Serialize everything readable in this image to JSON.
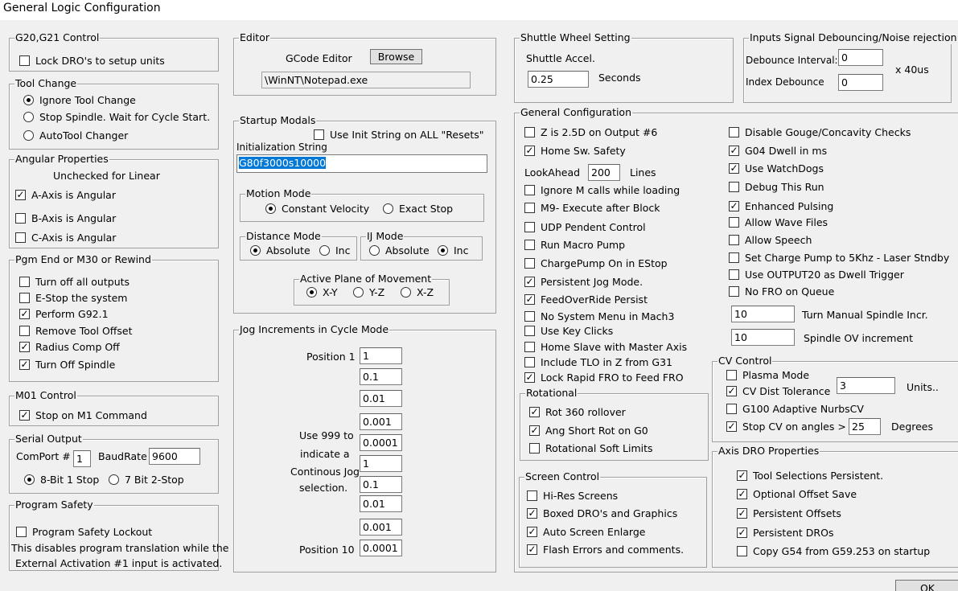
{
  "window": {
    "title": "General Logic Configuration",
    "ok_label": "OK"
  },
  "g20": {
    "legend": "G20,G21 Control",
    "lock_dro": {
      "label": "Lock DRO's to setup units",
      "checked": false
    }
  },
  "tool_change": {
    "legend": "Tool Change",
    "options": [
      {
        "label": "Ignore Tool Change",
        "selected": true
      },
      {
        "label": "Stop Spindle. Wait for Cycle Start.",
        "selected": false
      },
      {
        "label": "AutoTool Changer",
        "selected": false
      }
    ]
  },
  "angular": {
    "legend": "Angular Properties",
    "note": "Unchecked for Linear",
    "items": [
      {
        "label": "A-Axis is Angular",
        "checked": true
      },
      {
        "label": "B-Axis is Angular",
        "checked": false
      },
      {
        "label": "C-Axis is Angular",
        "checked": false
      }
    ]
  },
  "pgm_end": {
    "legend": "Pgm End or M30 or Rewind",
    "items": [
      {
        "label": "Turn off all outputs",
        "checked": false
      },
      {
        "label": "E-Stop the system",
        "checked": false
      },
      {
        "label": "Perform G92.1",
        "checked": true
      },
      {
        "label": "Remove Tool Offset",
        "checked": false
      },
      {
        "label": "Radius Comp Off",
        "checked": true
      },
      {
        "label": "Turn Off Spindle",
        "checked": true
      }
    ]
  },
  "m01": {
    "legend": "M01 Control",
    "stop_m1": {
      "label": "Stop on M1 Command",
      "checked": true
    }
  },
  "serial": {
    "legend": "Serial Output",
    "comport_label": "ComPort #",
    "comport_value": "1",
    "baud_label": "BaudRate",
    "baud_value": "9600",
    "bits_8": {
      "label": "8-Bit 1 Stop",
      "selected": true
    },
    "bits_7": {
      "label": "7 Bit 2-Stop",
      "selected": false
    }
  },
  "safety": {
    "legend": "Program Safety",
    "lockout": {
      "label": "Program Safety Lockout",
      "checked": false
    },
    "desc1": "This disables program translation while the",
    "desc2": "External Activation #1 input is activated."
  },
  "editor": {
    "legend": "Editor",
    "label": "GCode Editor",
    "browse": "Browse",
    "path": "\\WinNT\\Notepad.exe"
  },
  "startup": {
    "legend": "Startup Modals",
    "use_init": {
      "label": "Use Init String on ALL  \"Resets\"",
      "checked": false
    },
    "init_label": "Initialization String",
    "init_value": "G80f3000s10000",
    "motion": {
      "legend": "Motion Mode",
      "cv": {
        "label": "Constant Velocity",
        "selected": true
      },
      "es": {
        "label": "Exact Stop",
        "selected": false
      }
    },
    "distance": {
      "legend": "Distance Mode",
      "abs": {
        "label": "Absolute",
        "selected": true
      },
      "inc": {
        "label": "Inc",
        "selected": false
      }
    },
    "ij": {
      "legend": "IJ Mode",
      "abs": {
        "label": "Absolute",
        "selected": false
      },
      "inc": {
        "label": "Inc",
        "selected": true
      }
    },
    "plane": {
      "legend": "Active Plane of Movement",
      "xy": {
        "label": "X-Y",
        "selected": true
      },
      "yz": {
        "label": "Y-Z",
        "selected": false
      },
      "xz": {
        "label": "X-Z",
        "selected": false
      }
    }
  },
  "jog": {
    "legend": "Jog Increments in Cycle Mode",
    "pos1": "Position 1",
    "pos10": "Position 10",
    "note1": "Use 999 to",
    "note2": "indicate a",
    "note3": "Continous Jog",
    "note4": "selection.",
    "values": [
      "1",
      "0.1",
      "0.01",
      "0.001",
      "0.0001",
      "1",
      "0.1",
      "0.01",
      "0.001",
      "0.0001"
    ]
  },
  "shuttle": {
    "legend": "Shuttle Wheel Setting",
    "label": "Shuttle Accel.",
    "value": "0.25",
    "unit": "Seconds"
  },
  "debounce": {
    "legend": "Inputs Signal Debouncing/Noise rejection",
    "interval_label": "Debounce Interval:",
    "interval_value": "0",
    "index_label": "Index Debounce",
    "index_value": "0",
    "unit": "x 40us"
  },
  "general": {
    "legend": "General Configuration",
    "z25": {
      "label": "Z is 2.5D on Output #6",
      "checked": false
    },
    "home_safety": {
      "label": "Home Sw. Safety",
      "checked": true
    },
    "lookahead_label": "LookAhead",
    "lookahead_value": "200",
    "lookahead_unit": "Lines",
    "left": [
      {
        "label": "Ignore M calls while loading",
        "checked": false
      },
      {
        "label": "M9- Execute after Block",
        "checked": false
      },
      {
        "label": "UDP Pendent Control",
        "checked": false
      },
      {
        "label": "Run Macro Pump",
        "checked": false
      },
      {
        "label": "ChargePump On in EStop",
        "checked": false
      },
      {
        "label": "Persistent Jog Mode.",
        "checked": true
      },
      {
        "label": "FeedOverRide Persist",
        "checked": true
      },
      {
        "label": "No System Menu in Mach3",
        "checked": false
      },
      {
        "label": "Use Key Clicks",
        "checked": false
      },
      {
        "label": "Home Slave with Master Axis",
        "checked": false
      },
      {
        "label": "Include TLO in Z from G31",
        "checked": false
      },
      {
        "label": "Lock Rapid FRO to Feed FRO",
        "checked": true
      }
    ],
    "right": [
      {
        "label": "Disable Gouge/Concavity Checks",
        "checked": false
      },
      {
        "label": "G04 Dwell in ms",
        "checked": true
      },
      {
        "label": "Use WatchDogs",
        "checked": true
      },
      {
        "label": "Debug This Run",
        "checked": false
      },
      {
        "label": "Enhanced Pulsing",
        "checked": true
      },
      {
        "label": "Allow Wave Files",
        "checked": false
      },
      {
        "label": "Allow Speech",
        "checked": false
      },
      {
        "label": "Set Charge Pump to 5Khz  - Laser Stndby",
        "checked": false
      },
      {
        "label": "Use OUTPUT20 as Dwell Trigger",
        "checked": false
      },
      {
        "label": "No FRO on Queue",
        "checked": false
      }
    ],
    "spindle_incr_value": "10",
    "spindle_incr_label": "Turn Manual Spindle Incr.",
    "spindle_ov_value": "10",
    "spindle_ov_label": "Spindle OV increment"
  },
  "rotational": {
    "legend": "Rotational",
    "items": [
      {
        "label": "Rot 360 rollover",
        "checked": true
      },
      {
        "label": "Ang Short Rot on G0",
        "checked": true
      },
      {
        "label": "Rotational Soft Limits",
        "checked": false
      }
    ]
  },
  "cv": {
    "legend": "CV Control",
    "plasma": {
      "label": "Plasma Mode",
      "checked": false
    },
    "dist": {
      "label": "CV Dist Tolerance",
      "checked": true,
      "value": "3",
      "unit": "Units.."
    },
    "g100": {
      "label": "G100 Adaptive NurbsCV",
      "checked": false
    },
    "stop": {
      "label": "Stop CV on angles >",
      "checked": true,
      "value": "25",
      "unit": "Degrees"
    }
  },
  "screen": {
    "legend": "Screen Control",
    "items": [
      {
        "label": "Hi-Res Screens",
        "checked": false
      },
      {
        "label": "Boxed DRO's and Graphics",
        "checked": true
      },
      {
        "label": "Auto Screen Enlarge",
        "checked": true
      },
      {
        "label": "Flash Errors and comments.",
        "checked": true
      }
    ]
  },
  "axis_dro": {
    "legend": "Axis DRO Properties",
    "items": [
      {
        "label": "Tool Selections Persistent.",
        "checked": true
      },
      {
        "label": "Optional Offset Save",
        "checked": true
      },
      {
        "label": "Persistent Offsets",
        "checked": true
      },
      {
        "label": "Persistent DROs",
        "checked": true
      },
      {
        "label": "Copy G54 from G59.253 on startup",
        "checked": false
      }
    ]
  }
}
